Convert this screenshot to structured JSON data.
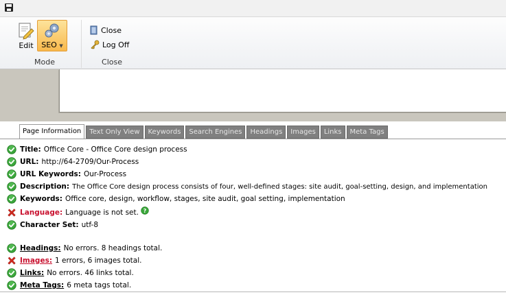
{
  "toolbar": {
    "edit_label": "Edit",
    "seo_label": "SEO",
    "mode_group": "Mode",
    "close_label": "Close",
    "logoff_label": "Log Off",
    "close_group": "Close"
  },
  "tabs": [
    {
      "label": "Page Information",
      "active": true
    },
    {
      "label": "Text Only View"
    },
    {
      "label": "Keywords"
    },
    {
      "label": "Search Engines"
    },
    {
      "label": "Headings"
    },
    {
      "label": "Images"
    },
    {
      "label": "Links"
    },
    {
      "label": "Meta Tags"
    }
  ],
  "info": {
    "title": {
      "label": "Title:",
      "value": "Office Core - Office Core design process",
      "status": "ok"
    },
    "url": {
      "label": "URL:",
      "value": "http://64-2709/Our-Process",
      "status": "ok"
    },
    "url_keywords": {
      "label": "URL Keywords:",
      "value": "Our-Process",
      "status": "ok"
    },
    "description": {
      "label": "Description:",
      "value": "The Office Core design process consists of four, well-defined stages: site audit, goal-setting, design, and implementation",
      "status": "ok"
    },
    "keywords": {
      "label": "Keywords:",
      "value": "Office core, design, workflow, stages, site audit, goal setting, implementation",
      "status": "ok"
    },
    "language": {
      "label": "Language:",
      "value": "Language is not set.",
      "status": "error"
    },
    "charset": {
      "label": "Character Set:",
      "value": "utf-8",
      "status": "ok"
    }
  },
  "summary": {
    "headings": {
      "label": "Headings:",
      "value": "No errors. 8 headings total.",
      "status": "ok"
    },
    "images": {
      "label": "Images:",
      "value": "1 errors, 6 images total.",
      "status": "error"
    },
    "links": {
      "label": "Links:",
      "value": "No errors. 46 links total.",
      "status": "ok"
    },
    "meta_tags": {
      "label": "Meta Tags:",
      "value": "6 meta tags total.",
      "status": "ok"
    }
  },
  "colors": {
    "ok": "#3aa63a",
    "error": "#d62a1f",
    "error_text": "#c8102e"
  }
}
